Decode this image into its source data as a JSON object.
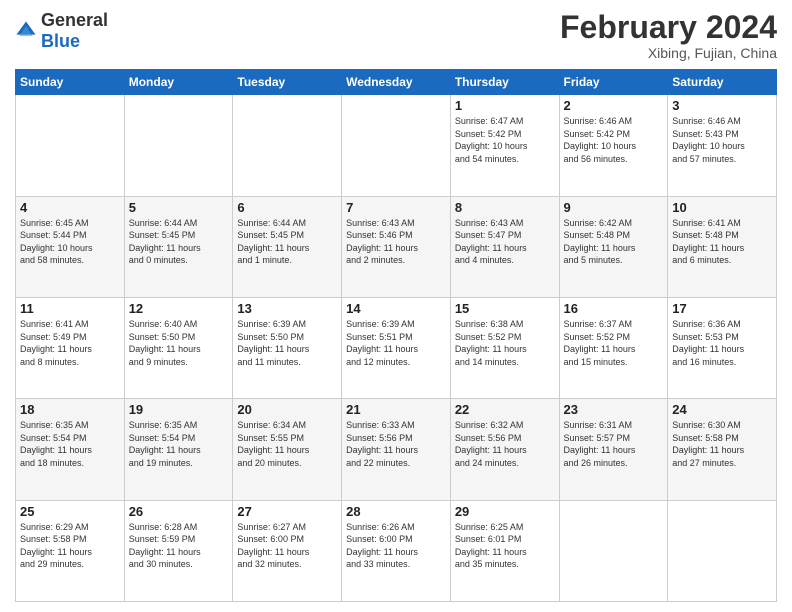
{
  "header": {
    "logo_general": "General",
    "logo_blue": "Blue",
    "month_title": "February 2024",
    "location": "Xibing, Fujian, China"
  },
  "days_of_week": [
    "Sunday",
    "Monday",
    "Tuesday",
    "Wednesday",
    "Thursday",
    "Friday",
    "Saturday"
  ],
  "weeks": [
    [
      {
        "day": "",
        "info": ""
      },
      {
        "day": "",
        "info": ""
      },
      {
        "day": "",
        "info": ""
      },
      {
        "day": "",
        "info": ""
      },
      {
        "day": "1",
        "info": "Sunrise: 6:47 AM\nSunset: 5:42 PM\nDaylight: 10 hours\nand 54 minutes."
      },
      {
        "day": "2",
        "info": "Sunrise: 6:46 AM\nSunset: 5:42 PM\nDaylight: 10 hours\nand 56 minutes."
      },
      {
        "day": "3",
        "info": "Sunrise: 6:46 AM\nSunset: 5:43 PM\nDaylight: 10 hours\nand 57 minutes."
      }
    ],
    [
      {
        "day": "4",
        "info": "Sunrise: 6:45 AM\nSunset: 5:44 PM\nDaylight: 10 hours\nand 58 minutes."
      },
      {
        "day": "5",
        "info": "Sunrise: 6:44 AM\nSunset: 5:45 PM\nDaylight: 11 hours\nand 0 minutes."
      },
      {
        "day": "6",
        "info": "Sunrise: 6:44 AM\nSunset: 5:45 PM\nDaylight: 11 hours\nand 1 minute."
      },
      {
        "day": "7",
        "info": "Sunrise: 6:43 AM\nSunset: 5:46 PM\nDaylight: 11 hours\nand 2 minutes."
      },
      {
        "day": "8",
        "info": "Sunrise: 6:43 AM\nSunset: 5:47 PM\nDaylight: 11 hours\nand 4 minutes."
      },
      {
        "day": "9",
        "info": "Sunrise: 6:42 AM\nSunset: 5:48 PM\nDaylight: 11 hours\nand 5 minutes."
      },
      {
        "day": "10",
        "info": "Sunrise: 6:41 AM\nSunset: 5:48 PM\nDaylight: 11 hours\nand 6 minutes."
      }
    ],
    [
      {
        "day": "11",
        "info": "Sunrise: 6:41 AM\nSunset: 5:49 PM\nDaylight: 11 hours\nand 8 minutes."
      },
      {
        "day": "12",
        "info": "Sunrise: 6:40 AM\nSunset: 5:50 PM\nDaylight: 11 hours\nand 9 minutes."
      },
      {
        "day": "13",
        "info": "Sunrise: 6:39 AM\nSunset: 5:50 PM\nDaylight: 11 hours\nand 11 minutes."
      },
      {
        "day": "14",
        "info": "Sunrise: 6:39 AM\nSunset: 5:51 PM\nDaylight: 11 hours\nand 12 minutes."
      },
      {
        "day": "15",
        "info": "Sunrise: 6:38 AM\nSunset: 5:52 PM\nDaylight: 11 hours\nand 14 minutes."
      },
      {
        "day": "16",
        "info": "Sunrise: 6:37 AM\nSunset: 5:52 PM\nDaylight: 11 hours\nand 15 minutes."
      },
      {
        "day": "17",
        "info": "Sunrise: 6:36 AM\nSunset: 5:53 PM\nDaylight: 11 hours\nand 16 minutes."
      }
    ],
    [
      {
        "day": "18",
        "info": "Sunrise: 6:35 AM\nSunset: 5:54 PM\nDaylight: 11 hours\nand 18 minutes."
      },
      {
        "day": "19",
        "info": "Sunrise: 6:35 AM\nSunset: 5:54 PM\nDaylight: 11 hours\nand 19 minutes."
      },
      {
        "day": "20",
        "info": "Sunrise: 6:34 AM\nSunset: 5:55 PM\nDaylight: 11 hours\nand 20 minutes."
      },
      {
        "day": "21",
        "info": "Sunrise: 6:33 AM\nSunset: 5:56 PM\nDaylight: 11 hours\nand 22 minutes."
      },
      {
        "day": "22",
        "info": "Sunrise: 6:32 AM\nSunset: 5:56 PM\nDaylight: 11 hours\nand 24 minutes."
      },
      {
        "day": "23",
        "info": "Sunrise: 6:31 AM\nSunset: 5:57 PM\nDaylight: 11 hours\nand 26 minutes."
      },
      {
        "day": "24",
        "info": "Sunrise: 6:30 AM\nSunset: 5:58 PM\nDaylight: 11 hours\nand 27 minutes."
      }
    ],
    [
      {
        "day": "25",
        "info": "Sunrise: 6:29 AM\nSunset: 5:58 PM\nDaylight: 11 hours\nand 29 minutes."
      },
      {
        "day": "26",
        "info": "Sunrise: 6:28 AM\nSunset: 5:59 PM\nDaylight: 11 hours\nand 30 minutes."
      },
      {
        "day": "27",
        "info": "Sunrise: 6:27 AM\nSunset: 6:00 PM\nDaylight: 11 hours\nand 32 minutes."
      },
      {
        "day": "28",
        "info": "Sunrise: 6:26 AM\nSunset: 6:00 PM\nDaylight: 11 hours\nand 33 minutes."
      },
      {
        "day": "29",
        "info": "Sunrise: 6:25 AM\nSunset: 6:01 PM\nDaylight: 11 hours\nand 35 minutes."
      },
      {
        "day": "",
        "info": ""
      },
      {
        "day": "",
        "info": ""
      }
    ]
  ]
}
